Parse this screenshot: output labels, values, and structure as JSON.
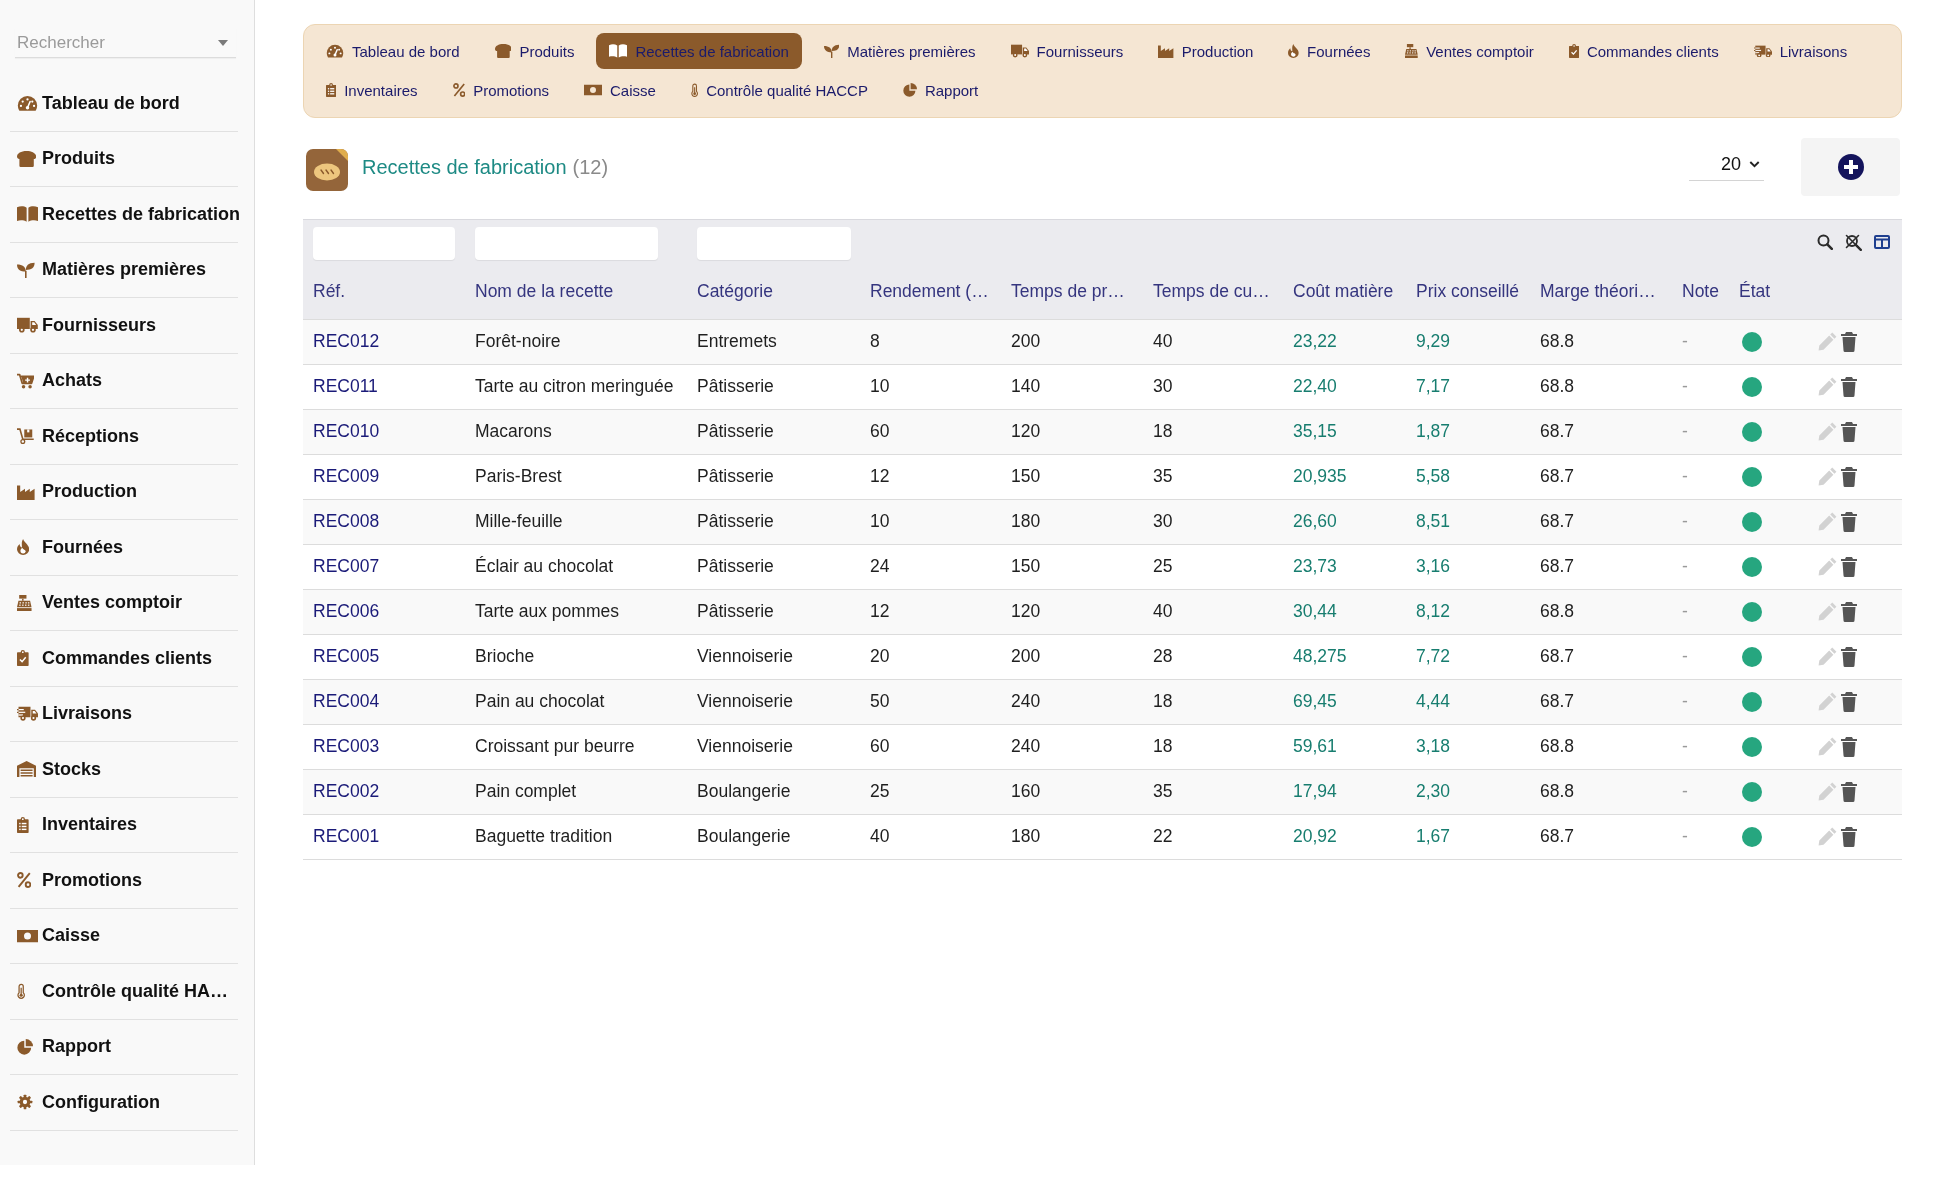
{
  "sidebar": {
    "search": {
      "placeholder": "Rechercher"
    },
    "items": [
      {
        "label": "Tableau de bord"
      },
      {
        "label": "Produits"
      },
      {
        "label": "Recettes de fabrication"
      },
      {
        "label": "Matières premières"
      },
      {
        "label": "Fournisseurs"
      },
      {
        "label": "Achats"
      },
      {
        "label": "Réceptions"
      },
      {
        "label": "Production"
      },
      {
        "label": "Fournées"
      },
      {
        "label": "Ventes comptoir"
      },
      {
        "label": "Commandes clients"
      },
      {
        "label": "Livraisons"
      },
      {
        "label": "Stocks"
      },
      {
        "label": "Inventaires"
      },
      {
        "label": "Promotions"
      },
      {
        "label": "Caisse"
      },
      {
        "label": "Contrôle qualité HA…"
      },
      {
        "label": "Rapport"
      },
      {
        "label": "Configuration"
      }
    ]
  },
  "tabs": [
    {
      "label": "Tableau de bord",
      "selected": false
    },
    {
      "label": "Produits",
      "selected": false
    },
    {
      "label": "Recettes de fabrication",
      "selected": true
    },
    {
      "label": "Matières premières",
      "selected": false
    },
    {
      "label": "Fournisseurs",
      "selected": false
    },
    {
      "label": "Production",
      "selected": false
    },
    {
      "label": "Fournées",
      "selected": false
    },
    {
      "label": "Ventes comptoir",
      "selected": false
    },
    {
      "label": "Commandes clients",
      "selected": false
    },
    {
      "label": "Livraisons",
      "selected": false
    },
    {
      "label": "Inventaires",
      "selected": false
    },
    {
      "label": "Promotions",
      "selected": false
    },
    {
      "label": "Caisse",
      "selected": false
    },
    {
      "label": "Contrôle qualité HACCP",
      "selected": false
    },
    {
      "label": "Rapport",
      "selected": false
    }
  ],
  "header": {
    "title": "Recettes de fabrication",
    "count": "(12)",
    "page_size": "20"
  },
  "table": {
    "columns": [
      {
        "label": "Réf.",
        "kind": "link",
        "filter": true
      },
      {
        "label": "Nom de la recette",
        "kind": "text",
        "filter": true
      },
      {
        "label": "Catégorie",
        "kind": "text",
        "filter": true
      },
      {
        "label": "Rendement (…",
        "kind": "text",
        "filter": false
      },
      {
        "label": "Temps de pr…",
        "kind": "text",
        "filter": false
      },
      {
        "label": "Temps de cu…",
        "kind": "text",
        "filter": false
      },
      {
        "label": "Coût matière",
        "kind": "amount",
        "filter": false
      },
      {
        "label": "Prix conseillé",
        "kind": "amount",
        "filter": false
      },
      {
        "label": "Marge théori…",
        "kind": "text",
        "filter": false
      },
      {
        "label": "Note",
        "kind": "muted",
        "filter": false
      },
      {
        "label": "État",
        "kind": "status",
        "filter": false
      }
    ],
    "rows": [
      {
        "cells": [
          "REC012",
          "Forêt-noire",
          "Entremets",
          "8",
          "200",
          "40",
          "23,22",
          "9,29",
          "68.8",
          "-"
        ],
        "active": true
      },
      {
        "cells": [
          "REC011",
          "Tarte au citron meringuée",
          "Pâtisserie",
          "10",
          "140",
          "30",
          "22,40",
          "7,17",
          "68.8",
          "-"
        ],
        "active": true
      },
      {
        "cells": [
          "REC010",
          "Macarons",
          "Pâtisserie",
          "60",
          "120",
          "18",
          "35,15",
          "1,87",
          "68.7",
          "-"
        ],
        "active": true
      },
      {
        "cells": [
          "REC009",
          "Paris-Brest",
          "Pâtisserie",
          "12",
          "150",
          "35",
          "20,935",
          "5,58",
          "68.7",
          "-"
        ],
        "active": true
      },
      {
        "cells": [
          "REC008",
          "Mille-feuille",
          "Pâtisserie",
          "10",
          "180",
          "30",
          "26,60",
          "8,51",
          "68.7",
          "-"
        ],
        "active": true
      },
      {
        "cells": [
          "REC007",
          "Éclair au chocolat",
          "Pâtisserie",
          "24",
          "150",
          "25",
          "23,73",
          "3,16",
          "68.7",
          "-"
        ],
        "active": true
      },
      {
        "cells": [
          "REC006",
          "Tarte aux pommes",
          "Pâtisserie",
          "12",
          "120",
          "40",
          "30,44",
          "8,12",
          "68.8",
          "-"
        ],
        "active": true
      },
      {
        "cells": [
          "REC005",
          "Brioche",
          "Viennoiserie",
          "20",
          "200",
          "28",
          "48,275",
          "7,72",
          "68.7",
          "-"
        ],
        "active": true
      },
      {
        "cells": [
          "REC004",
          "Pain au chocolat",
          "Viennoiserie",
          "50",
          "240",
          "18",
          "69,45",
          "4,44",
          "68.7",
          "-"
        ],
        "active": true
      },
      {
        "cells": [
          "REC003",
          "Croissant pur beurre",
          "Viennoiserie",
          "60",
          "240",
          "18",
          "59,61",
          "3,18",
          "68.8",
          "-"
        ],
        "active": true
      },
      {
        "cells": [
          "REC002",
          "Pain complet",
          "Boulangerie",
          "25",
          "160",
          "35",
          "17,94",
          "2,30",
          "68.8",
          "-"
        ],
        "active": true
      },
      {
        "cells": [
          "REC001",
          "Baguette tradition",
          "Boulangerie",
          "40",
          "180",
          "22",
          "20,92",
          "1,67",
          "68.7",
          "-"
        ],
        "active": true
      }
    ]
  }
}
